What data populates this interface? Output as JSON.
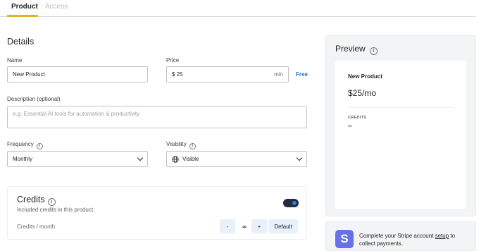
{
  "tabs": [
    {
      "label": "Product",
      "active": true
    },
    {
      "label": "Access",
      "active": false
    }
  ],
  "details": {
    "title": "Details",
    "name_label": "Name",
    "name_value": "New Product",
    "price_label": "Price",
    "price_value": "$ 25",
    "price_suffix": "min",
    "free_link": "Free",
    "description_label": "Description (optional)",
    "description_placeholder": "e.g. Essential AI tools for automation & productivity",
    "frequency_label": "Frequency",
    "frequency_value": "Monthly",
    "visibility_label": "Visibility",
    "visibility_value": "Visible"
  },
  "credits": {
    "title": "Credits",
    "subtitle": "Included credits in this product.",
    "enabled": true,
    "per_label": "Credits / month",
    "minus": "-",
    "value": "∞",
    "plus": "+",
    "default_label": "Default"
  },
  "preview": {
    "title": "Preview",
    "product_name": "New Product",
    "price": "$25/mo",
    "credits_label": "CREDITS",
    "credits_value": "∞"
  },
  "stripe": {
    "logo_letter": "S",
    "text_before": "Complete your Stripe account ",
    "link": "setup",
    "text_after": " to collect payments."
  },
  "colors": {
    "accent": "#e1b12c",
    "link": "#1a73c9",
    "stripe": "#6772e5"
  }
}
